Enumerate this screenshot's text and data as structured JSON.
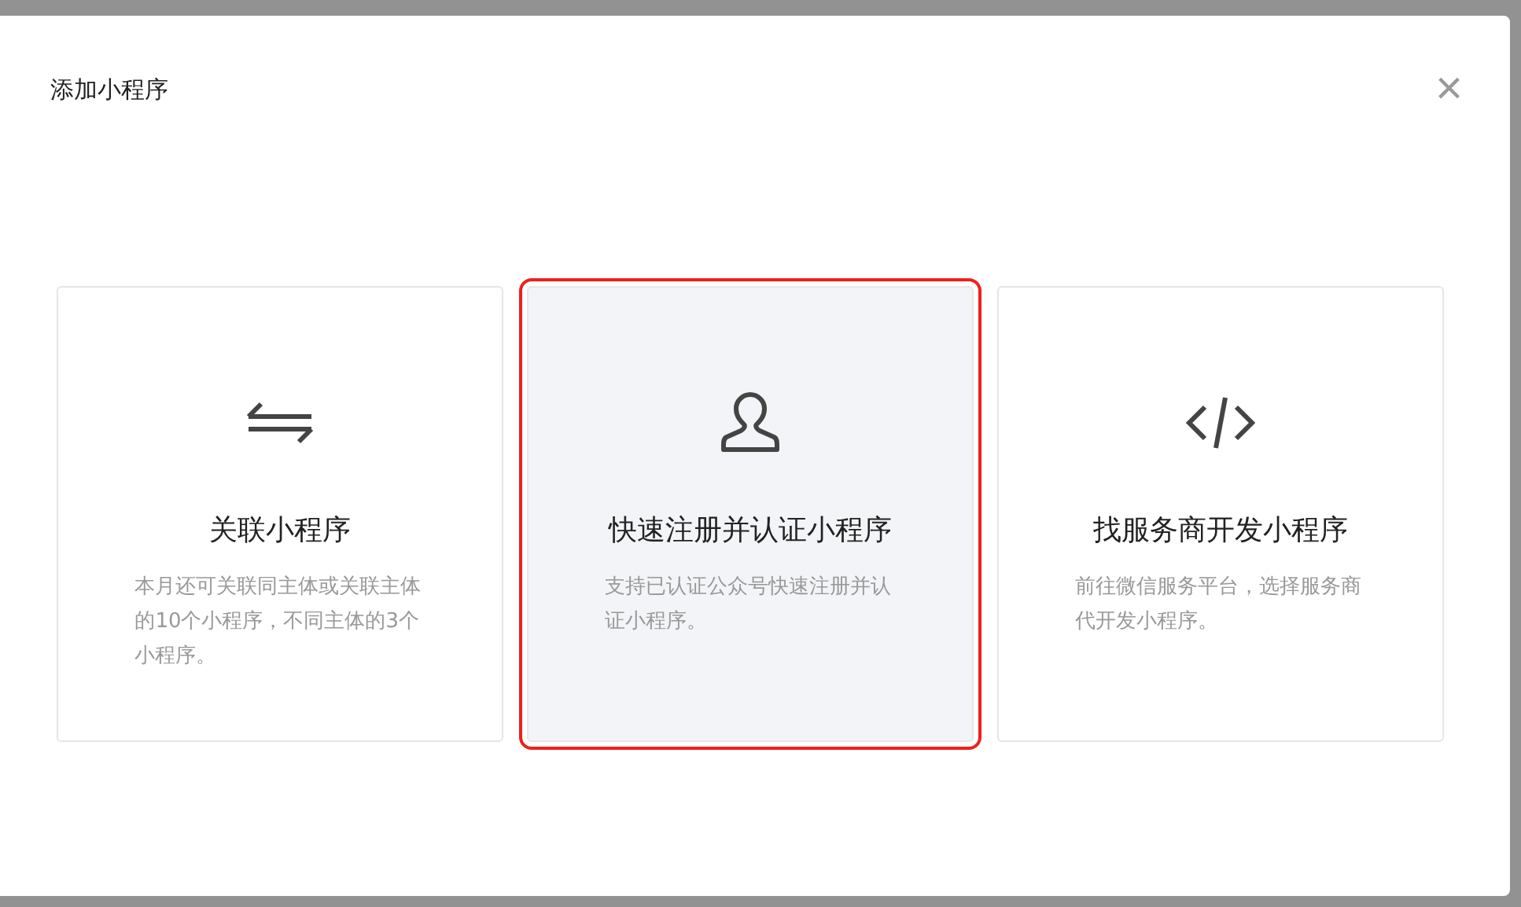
{
  "dialog": {
    "title": "添加小程序",
    "close": "×"
  },
  "options": [
    {
      "kind": "link",
      "title": "关联小程序",
      "description": "本月还可关联同主体或关联主体的10个小程序，不同主体的3个小程序。",
      "selected": false
    },
    {
      "kind": "user",
      "title": "快速注册并认证小程序",
      "description": "支持已认证公众号快速注册并认证小程序。",
      "selected": true
    },
    {
      "kind": "code",
      "title": "找服务商开发小程序",
      "description": "前往微信服务平台，选择服务商代开发小程序。",
      "selected": false
    }
  ]
}
